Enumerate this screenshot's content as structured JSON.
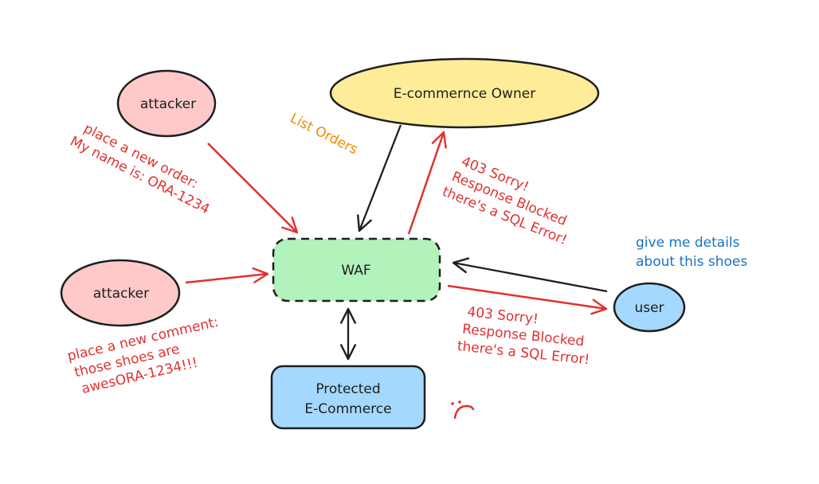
{
  "colors": {
    "stroke": "#1e1e1e",
    "red": "#e03131",
    "orange": "#f08c00",
    "blue": "#1971c2",
    "attacker_fill": "#ffc9c9",
    "owner_fill": "#ffec99",
    "waf_fill": "#b2f2bb",
    "ecommerce_fill": "#a5d8ff",
    "user_fill": "#a5d8ff"
  },
  "nodes": {
    "attacker_top": {
      "label": "attacker"
    },
    "attacker_bottom": {
      "label": "attacker"
    },
    "owner": {
      "label": "E-commernce Owner"
    },
    "waf": {
      "label": "WAF"
    },
    "ecommerce": {
      "label_lines": [
        "Protected",
        "E-Commerce"
      ]
    },
    "user": {
      "label": "user"
    }
  },
  "notes": {
    "order_request": {
      "lines": [
        "place a new order:",
        "My name is: ORA-1234"
      ]
    },
    "comment_request": {
      "lines": [
        "place a new comment:",
        "those shoes are",
        "awesORA-1234!!!"
      ]
    },
    "list_orders": {
      "lines": [
        "List Orders"
      ]
    },
    "owner_blocked": {
      "lines": [
        "403 Sorry!",
        "Response Blocked",
        "there's a SQL Error!"
      ]
    },
    "user_blocked": {
      "lines": [
        "403 Sorry!",
        "Response Blocked",
        "there's a SQL Error!"
      ]
    },
    "user_request": {
      "lines": [
        "give me details",
        "about this shoes"
      ]
    }
  },
  "icons": {
    "sad_face": "sad-face-icon"
  }
}
